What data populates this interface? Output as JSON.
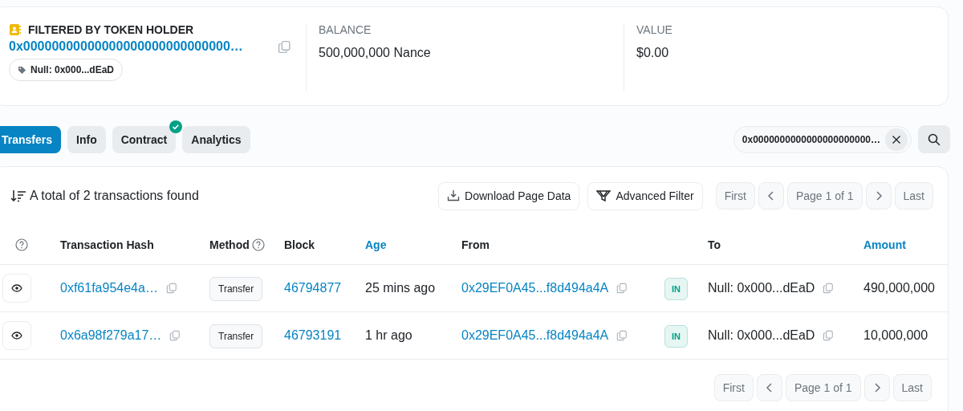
{
  "holder": {
    "label": "FILTERED BY TOKEN HOLDER",
    "address": "0x00000000000000000000000000000…",
    "tag": "Null: 0x000...dEaD"
  },
  "stats": [
    {
      "label": "BALANCE",
      "value": "500,000,000 Nance"
    },
    {
      "label": "VALUE",
      "value": "$0.00"
    }
  ],
  "tabs": [
    {
      "label": "Transfers",
      "selected": true,
      "verified": false
    },
    {
      "label": "Info",
      "selected": false,
      "verified": false
    },
    {
      "label": "Contract",
      "selected": false,
      "verified": true
    },
    {
      "label": "Analytics",
      "selected": false,
      "verified": false
    }
  ],
  "filter_chip": "0x0000000000000000000000…",
  "summary": "A total of 2 transactions found",
  "actions": [
    "Download Page Data",
    "Advanced Filter"
  ],
  "pagination_top": {
    "first": "First",
    "page": "Page 1 of 1",
    "last": "Last",
    "disabled": true
  },
  "columns": [
    {
      "label": "Transaction Hash",
      "sortable": false,
      "help": false
    },
    {
      "label": "Method",
      "sortable": false,
      "help": true
    },
    {
      "label": "Block",
      "sortable": false,
      "help": false
    },
    {
      "label": "Age",
      "sortable": true,
      "help": false
    },
    {
      "label": "From",
      "sortable": false,
      "help": false
    },
    {
      "label": "To",
      "sortable": false,
      "help": false
    },
    {
      "label": "Amount",
      "sortable": true,
      "help": false
    }
  ],
  "rows": [
    {
      "hash": "0xf61fa954e4a…",
      "method": "Transfer",
      "block": "46794877",
      "age": "25 mins ago",
      "from": "0x29EF0A45...f8d494a4A",
      "direction": "IN",
      "to": "Null: 0x000...dEaD",
      "amount": "490,000,000"
    },
    {
      "hash": "0x6a98f279a17…",
      "method": "Transfer",
      "block": "46793191",
      "age": "1 hr ago",
      "from": "0x29EF0A45...f8d494a4A",
      "direction": "IN",
      "to": "Null: 0x000...dEaD",
      "amount": "10,000,000"
    }
  ],
  "pagination_bottom": {
    "first": "First",
    "page": "Page 1 of 1",
    "last": "Last",
    "disabled": true
  }
}
